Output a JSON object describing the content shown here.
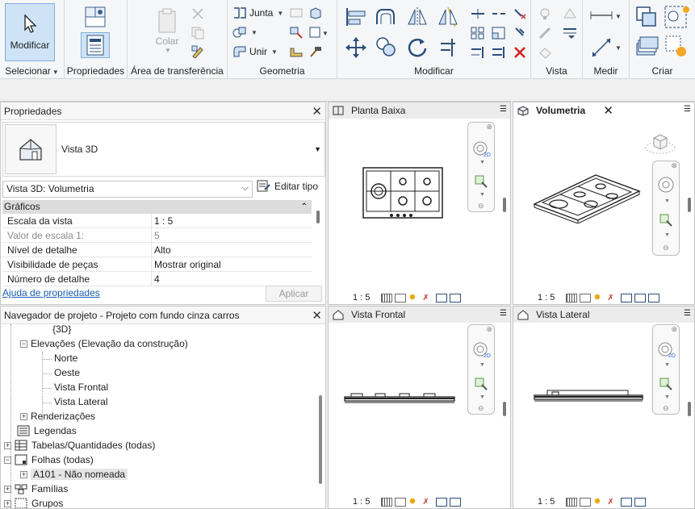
{
  "ribbon": {
    "selecionar": {
      "button_label": "Modificar",
      "group_label": "Selecionar"
    },
    "propriedades": {
      "group_label": "Propriedades"
    },
    "clipboard": {
      "colar_label": "Colar",
      "group_label": "Área de transferência"
    },
    "geometria": {
      "junta_label": "Junta",
      "unir_label": "Unir",
      "group_label": "Geometria"
    },
    "modificar": {
      "group_label": "Modificar"
    },
    "vista": {
      "group_label": "Vista"
    },
    "medir": {
      "group_label": "Medir"
    },
    "criar": {
      "group_label": "Criar"
    }
  },
  "properties": {
    "title": "Propriedades",
    "type_name": "Vista 3D",
    "instance_selector": "Vista 3D: Volumetria",
    "edit_type_label": "Editar tipo",
    "category": "Gráficos",
    "rows": [
      {
        "key": "Escala da vista",
        "value": "1 : 5",
        "muted": false
      },
      {
        "key": "Valor de escala    1:",
        "value": "5",
        "muted": true
      },
      {
        "key": "Nível de detalhe",
        "value": "Alto",
        "muted": false
      },
      {
        "key": "Visibilidade de peças",
        "value": "Mostrar original",
        "muted": false
      },
      {
        "key": "Número de detalhe",
        "value": "4",
        "muted": false
      }
    ],
    "help_link": "Ajuda de propriedades",
    "apply_label": "Aplicar"
  },
  "browser": {
    "title": "Navegador de projeto - Projeto com fundo cinza carros",
    "items": [
      {
        "label": "{3D}"
      },
      {
        "label": "Elevações (Elevação da construção)"
      },
      {
        "label": "Norte"
      },
      {
        "label": "Oeste"
      },
      {
        "label": "Vista Frontal"
      },
      {
        "label": "Vista Lateral"
      },
      {
        "label": "Renderizações"
      },
      {
        "label": "Legendas"
      },
      {
        "label": "Tabelas/Quantidades (todas)"
      },
      {
        "label": "Folhas (todas)"
      },
      {
        "label": "A101 - Não nomeada"
      },
      {
        "label": "Famílias"
      },
      {
        "label": "Grupos"
      }
    ]
  },
  "views": [
    {
      "title": "Planta Baixa",
      "scale": "1 : 5",
      "active": false
    },
    {
      "title": "Volumetria",
      "scale": "1 : 5",
      "active": true
    },
    {
      "title": "Vista Frontal",
      "scale": "1 : 5",
      "active": false
    },
    {
      "title": "Vista Lateral",
      "scale": "1 : 5",
      "active": false
    }
  ],
  "colors": {
    "accent": "#1a5fb4",
    "selected_button": "#cfe3f7",
    "category_header": "#dcdcdc"
  },
  "icons": [
    "cursor-icon",
    "properties-icon",
    "paste-icon",
    "cut-icon",
    "join-icon",
    "align-icon",
    "move-icon",
    "rotate-icon",
    "mirror-icon",
    "delete-icon",
    "measure-icon",
    "create-icon",
    "house-icon",
    "viewcube-icon",
    "steering-wheel-icon",
    "zoom-icon"
  ]
}
